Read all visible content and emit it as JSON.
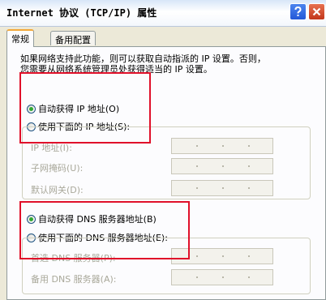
{
  "window": {
    "title": "Internet 协议 (TCP/IP) 属性",
    "controls": {
      "help_icon": "question-icon",
      "close_icon": "close-icon"
    }
  },
  "tabs": [
    {
      "label": "常规",
      "active": true
    },
    {
      "label": "备用配置",
      "active": false
    }
  ],
  "description": {
    "line1": "如果网络支持此功能，则可以获取自动指派的 IP 设置。否则，",
    "line2": "您需要从网络系统管理员处获得适当的 IP 设置。"
  },
  "ip_mode": {
    "auto_label": "自动获得 IP 地址(O)",
    "manual_label": "使用下面的 IP 地址(S):",
    "selected": "auto"
  },
  "ip_fields": [
    {
      "label": "IP 地址(I):",
      "value": ""
    },
    {
      "label": "子网掩码(U):",
      "value": ""
    },
    {
      "label": "默认网关(D):",
      "value": ""
    }
  ],
  "dns_mode": {
    "auto_label": "自动获得 DNS 服务器地址(B)",
    "manual_label": "使用下面的 DNS 服务器地址(E):",
    "selected": "auto"
  },
  "dns_fields": [
    {
      "label": "首选 DNS 服务器(P):",
      "value": ""
    },
    {
      "label": "备用 DNS 服务器(A):",
      "value": ""
    }
  ],
  "colors": {
    "dialog_bg": "#ece9d8",
    "highlight_border": "#e0102a",
    "radio_selected": "#31a931",
    "disabled_text": "#a9a89a"
  }
}
